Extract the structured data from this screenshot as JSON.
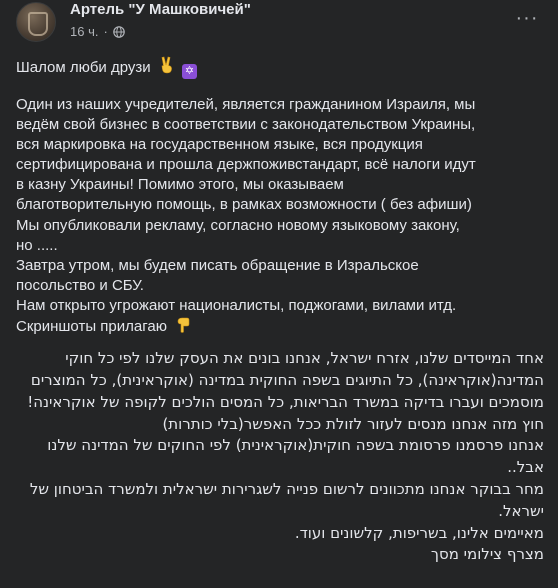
{
  "post": {
    "author": "Артель \"У Машковичей\"",
    "time": "16 ч.",
    "separator": "·",
    "more_label": "···"
  },
  "icons": {
    "audience": "globe-icon",
    "reaction_victory": "victory-hand-icon",
    "reaction_star": "star-of-david-icon",
    "pointing": "pointing-down-icon"
  },
  "body": {
    "greeting": "Шалом люби друзи",
    "ru_lines": [
      "Один из наших учредителей, является гражданином Израиля, мы",
      "ведём свой бизнес в соответствии с законодательством Украины,",
      "вся маркировка на государственном языке, вся продукция",
      "сертифицирована и прошла держпоживстандарт, всё налоги идут",
      "в казну Украины! Помимо этого, мы оказываем",
      "благотворительную помощь, в рамках возможности ( без афиши)",
      "Мы опубликовали рекламу, согласно новому языковому закону,",
      "но .....",
      "Завтра утром, мы будем писать обращение в Изральское",
      "посольство и СБУ.",
      "Нам открыто угрожают националисты, поджогами, вилами итд."
    ],
    "screenshots_line": "Скриншоты прилагаю",
    "he_lines": [
      "אחד המייסדים שלנו, אזרח ישראל, אנחנו בונים את העסק שלנו לפי כל חוקי",
      "המדינה(אוקראינה), כל התיוגים בשפה החוקית במדינה (אוקראינית), כל המוצרים",
      "מוסמכים ועברו בדיקה במשרד הבריאות, כל המסים הולכים לקופה של אוקראינה!",
      "חוץ מזה אנחנו מנסים לעזור לזולת ככל האפשר(בלי כותרות)",
      "אנחנו פרסמנו פרסומת בשפה חוקית(אוקראינית) לפי החוקים של המדינה שלנו",
      "אבל..",
      "מחר בבוקר אנחנו מתכוונים לרשום פנייה לשגרירות ישראלית ולמשרד הביטחון של",
      "ישראל.",
      "מאיימים אלינו, בשריפות, קלשונים ועוד.",
      "מצרף צילומי מסך"
    ]
  }
}
